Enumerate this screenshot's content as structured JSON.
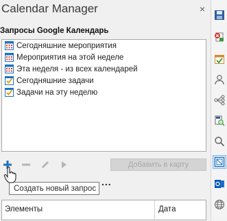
{
  "panel": {
    "title": "Calendar Manager",
    "close_symbol": "×",
    "section_label": "Запросы Google Календарь"
  },
  "queries": [
    {
      "label": "Сегодняшние мероприятия",
      "icon": "calendar-grid-icon"
    },
    {
      "label": "Мероприятия на этой неделе",
      "icon": "calendar-grid-icon"
    },
    {
      "label": "Эта неделя - из всех календарей",
      "icon": "calendar-grid-icon"
    },
    {
      "label": "Сегодняшние задачи",
      "icon": "checkbox-task-icon"
    },
    {
      "label": "Задачи на эту неделю",
      "icon": "checkbox-task-icon"
    }
  ],
  "toolbar": {
    "add_map_label": "Добавить в карту",
    "tooltip": "Создать новый запрос",
    "more": "..."
  },
  "table": {
    "col_elements": "Элементы",
    "col_date": "Дата"
  },
  "sidebar": {
    "icons": [
      "save-icon",
      "delete-page-icon",
      "calendar-check-icon",
      "user-icon",
      "link-tree-icon",
      "search-page-icon",
      "search-icon",
      "calendar-active-icon",
      "outlook-icon",
      "globe-icon"
    ]
  },
  "colors": {
    "accent": "#1e73be",
    "tooltip_border": "#767676"
  }
}
